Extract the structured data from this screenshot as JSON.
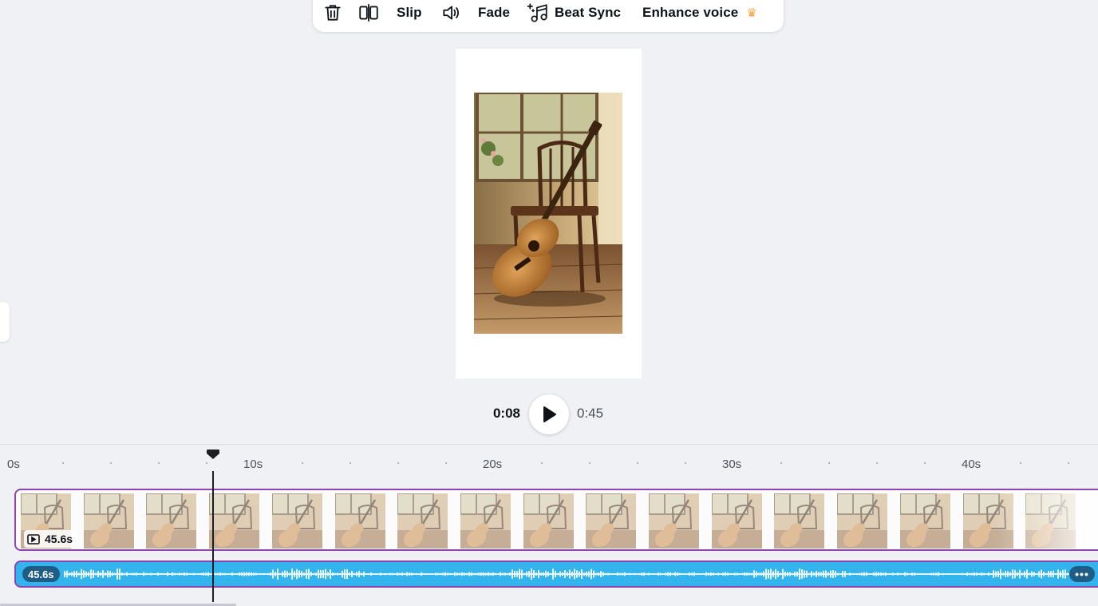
{
  "toolbar": {
    "items": [
      {
        "name": "delete",
        "label": "",
        "icon": "trash-icon"
      },
      {
        "name": "split",
        "label": "",
        "icon": "split-icon"
      },
      {
        "name": "slip",
        "label": "Slip"
      },
      {
        "name": "volume",
        "label": "",
        "icon": "volume-icon"
      },
      {
        "name": "fade",
        "label": "Fade"
      },
      {
        "name": "beat-sync",
        "label": "Beat Sync",
        "icon": "music-sparkle-icon"
      },
      {
        "name": "enhance-voice",
        "label": "Enhance voice",
        "badge_icon": "crown-icon"
      }
    ],
    "slip_label": "Slip",
    "fade_label": "Fade",
    "beat_sync_label": "Beat Sync",
    "enhance_voice_label": "Enhance voice",
    "premium_color": "#f2a33a"
  },
  "playback": {
    "current_time": "0:08",
    "total_time": "0:45",
    "play_icon": "play-icon"
  },
  "timeline": {
    "ruler_labels": [
      "0s",
      "10s",
      "20s",
      "30s",
      "40s"
    ],
    "playhead_seconds": 8.3,
    "video_track": {
      "duration": "45.6s",
      "icon": "video-clip-icon",
      "thumbnail_count": 17,
      "border_color": "#8e44ad"
    },
    "audio_track": {
      "duration": "45.6s",
      "color": "#33b4ec",
      "more_icon": "more-options-icon"
    }
  },
  "canvas": {
    "image_subject": "acoustic-guitar-on-chair-image"
  }
}
